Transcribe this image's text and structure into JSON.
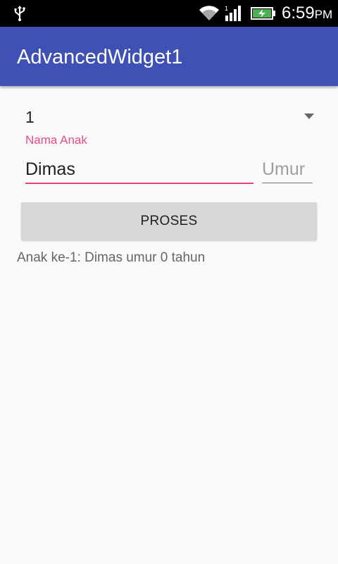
{
  "status_bar": {
    "time": "6:59",
    "ampm": "PM",
    "icons": [
      "usb-icon",
      "wifi-icon",
      "signal-icon",
      "battery-charging-icon"
    ],
    "signal_label": "1"
  },
  "app_bar": {
    "title": "AdvancedWidget1",
    "color": "#3f51b5"
  },
  "form": {
    "spinner_value": "1",
    "nama_label": "Nama Anak",
    "nama_value": "Dimas",
    "umur_placeholder": "Umur",
    "umur_value": "",
    "accent_color": "#ec407a"
  },
  "button": {
    "label": "PROSES"
  },
  "result": {
    "text": "Anak ke-1: Dimas umur 0 tahun"
  }
}
